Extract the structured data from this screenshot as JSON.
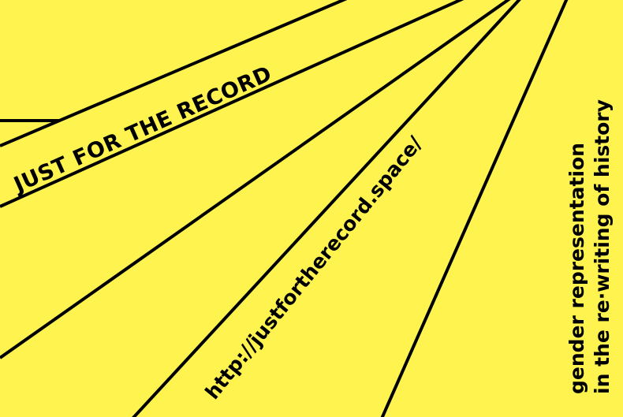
{
  "colors": {
    "background": "#FFF350",
    "ink": "#000000"
  },
  "poster": {
    "title": "JUST FOR THE RECORD",
    "url": "http://justfortherecord.space/",
    "tagline": {
      "line1": "gender representation",
      "line2": "in the re·writing of history"
    }
  }
}
